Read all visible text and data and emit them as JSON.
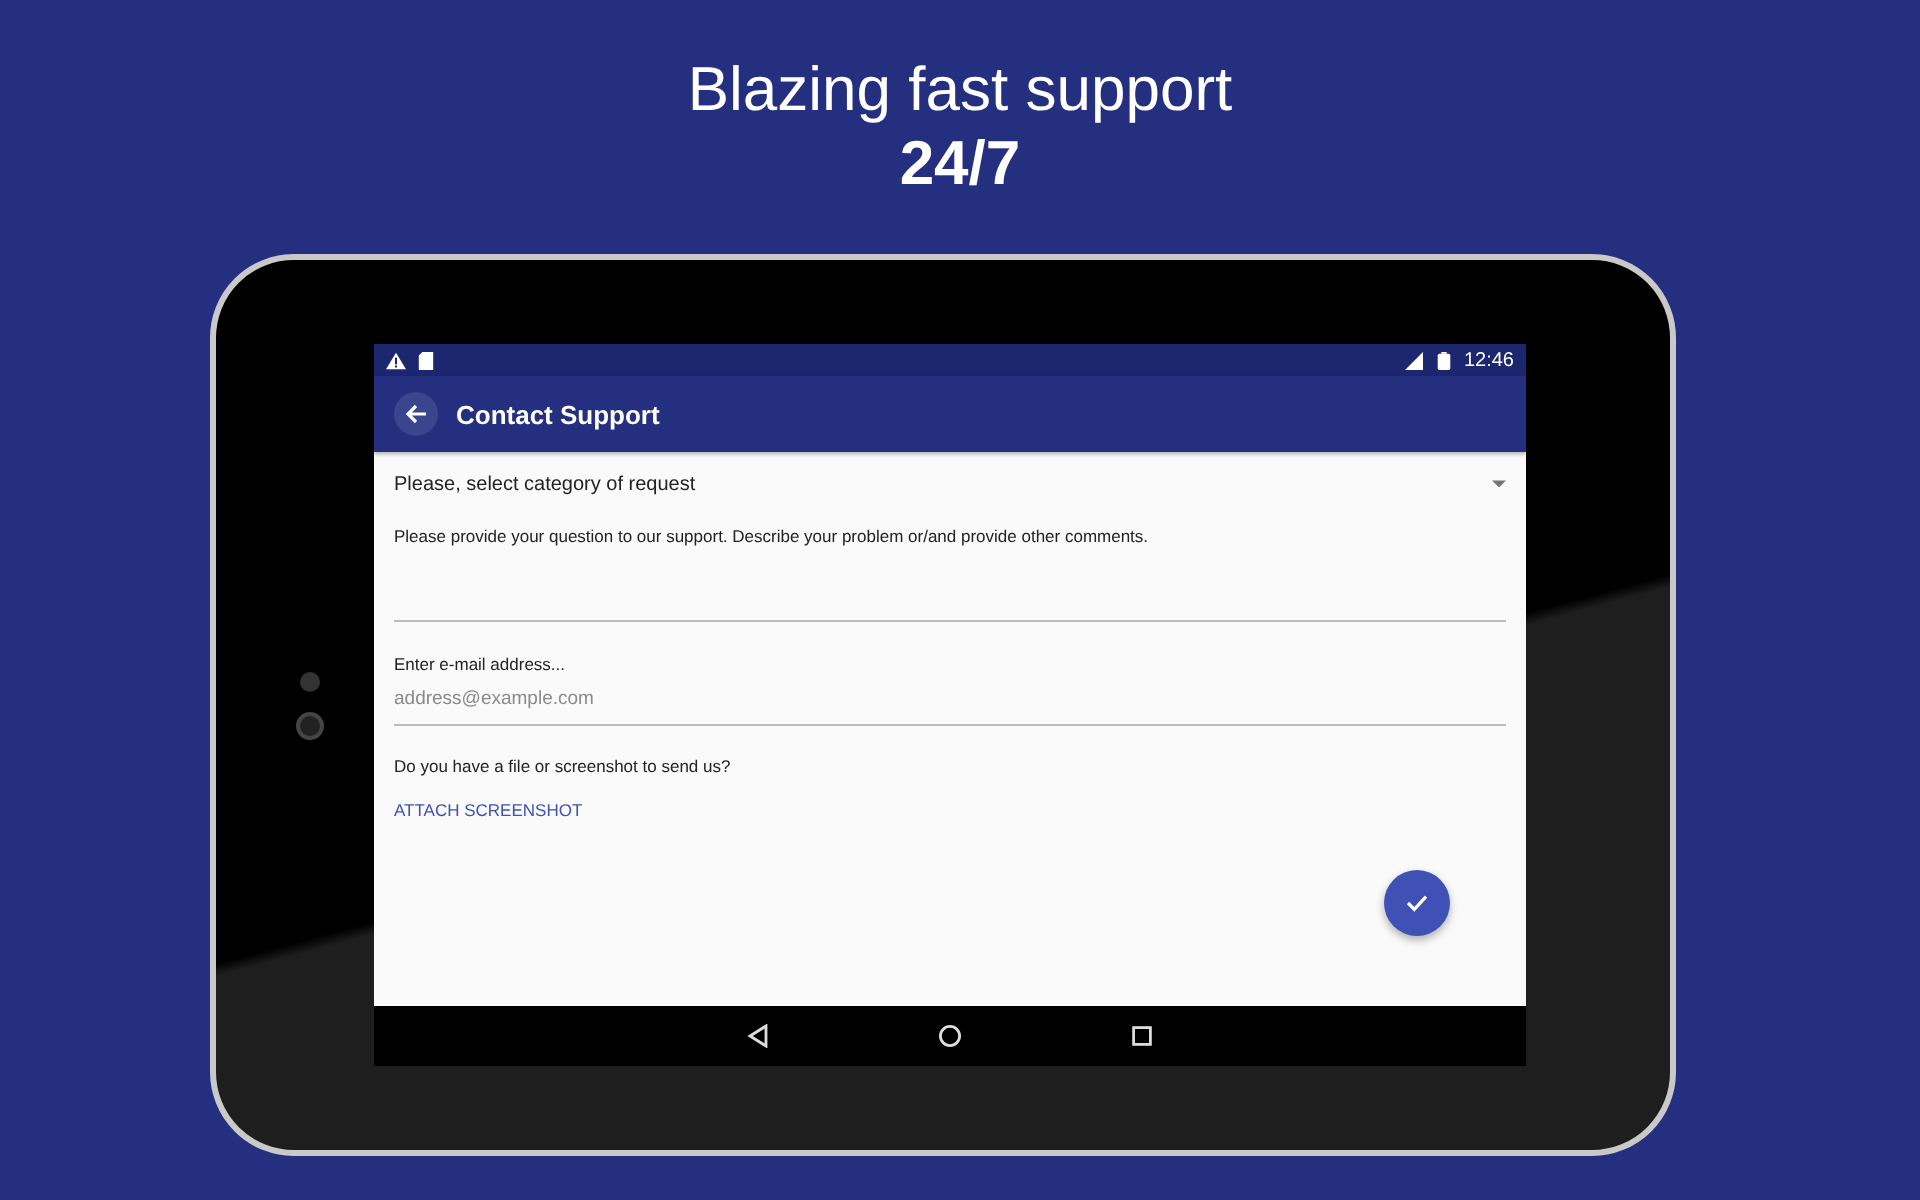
{
  "headline": "Blazing fast support",
  "subheadline": "24/7",
  "status_bar": {
    "time": "12:46"
  },
  "app_bar": {
    "title": "Contact Support"
  },
  "form": {
    "category_select": {
      "placeholder": "Please, select category of request"
    },
    "question_field": {
      "placeholder": "Please provide your question to our support. Describe your problem or/and provide other comments."
    },
    "email_field": {
      "label": "Enter e-mail address...",
      "placeholder": "address@example.com"
    },
    "attachment": {
      "prompt": "Do you have a file or screenshot to send us?",
      "link": "ATTACH SCREENSHOT"
    }
  }
}
